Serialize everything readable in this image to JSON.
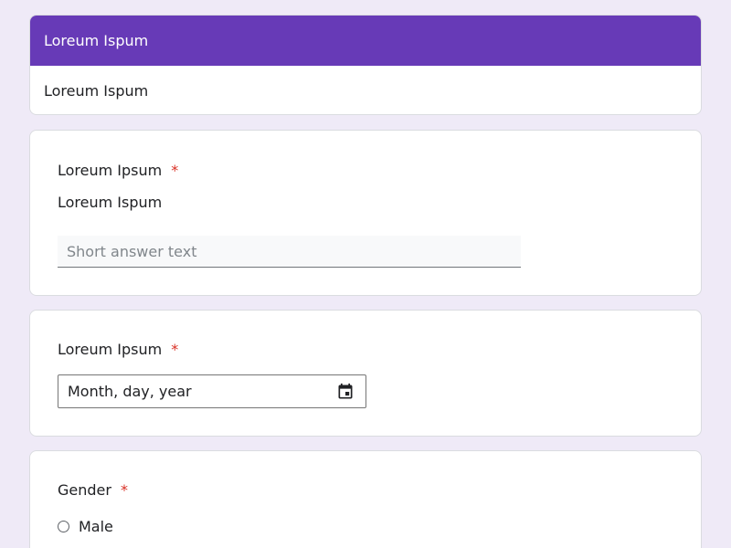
{
  "header": {
    "title": "Loreum Ispum",
    "description": "Loreum Ispum"
  },
  "questions": [
    {
      "title": "Loreum Ipsum",
      "required_marker": "*",
      "description": "Loreum Ispum",
      "answer_placeholder": "Short answer text"
    },
    {
      "title": "Loreum Ipsum",
      "required_marker": "*",
      "date_placeholder": "Month, day, year",
      "icon": "calendar-icon"
    },
    {
      "title": "Gender",
      "required_marker": "*",
      "options": [
        "Male"
      ]
    }
  ],
  "colors": {
    "background": "#efeaf7",
    "header_band": "#673ab7",
    "required": "#d93025"
  }
}
